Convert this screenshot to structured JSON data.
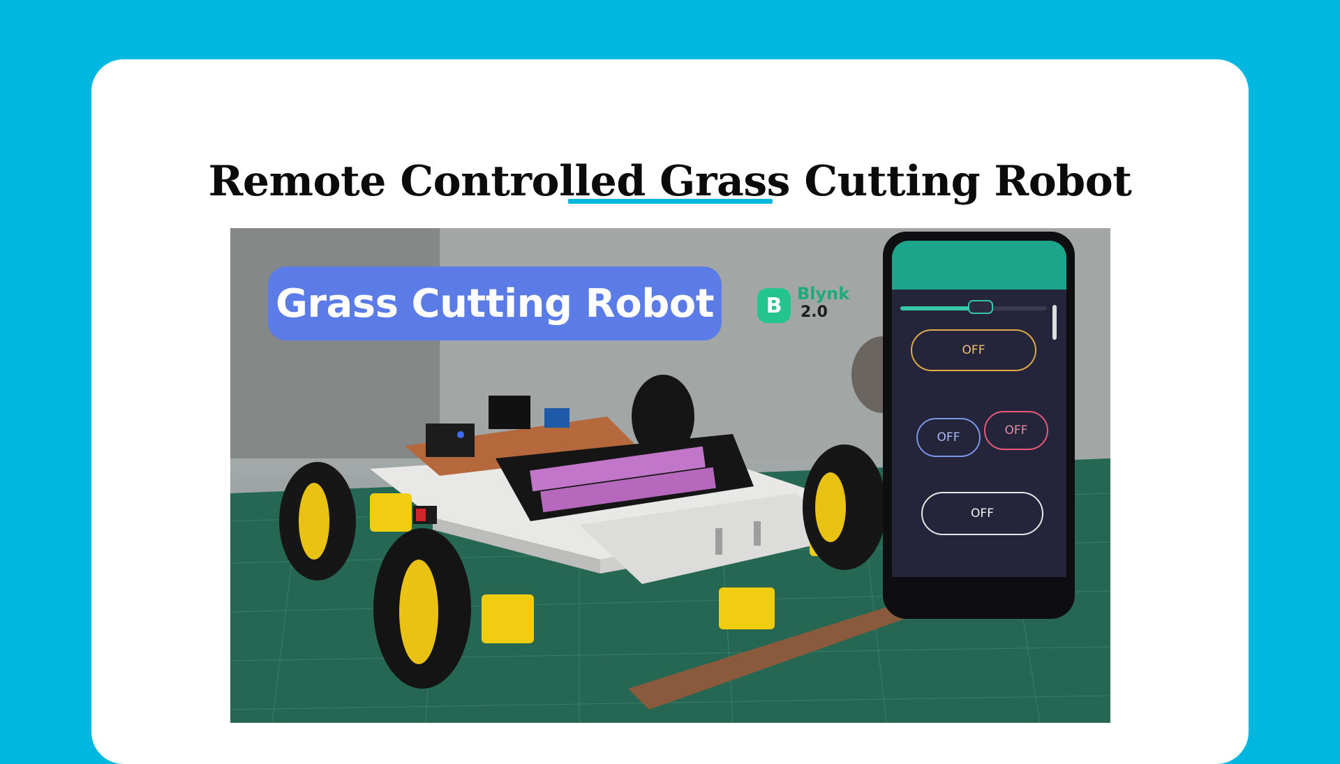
{
  "page": {
    "title": "Remote Controlled Grass Cutting Robot",
    "background_color": "#00b8df",
    "accent_color": "#00b8df"
  },
  "photo": {
    "description_icon": "robot-photo",
    "banner_text": "Grass Cutting Robot",
    "banner_color": "#5b7be6",
    "blynk": {
      "logo_letter": "B",
      "name": "Blynk",
      "version": "2.0",
      "color": "#23c48e"
    },
    "phone": {
      "forward_label": "OFF",
      "left_label": "OFF",
      "right_label": "OFF",
      "backward_label": "OFF"
    }
  }
}
